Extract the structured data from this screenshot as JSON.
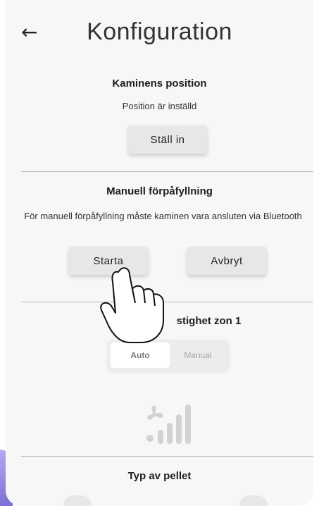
{
  "header": {
    "back_icon": "arrow-left-icon",
    "title": "Konfiguration"
  },
  "position_section": {
    "title": "Kaminens position",
    "status": "Position är inställd",
    "set_button_label": "Ställ in"
  },
  "prefill_section": {
    "title": "Manuell förpåfyllning",
    "description": "För manuell förpåfyllning måste kaminen vara ansluten via Bluetooth",
    "start_button_label": "Starta",
    "cancel_button_label": "Avbryt"
  },
  "fan_section": {
    "title": "stighet zon 1",
    "auto_label": "Auto",
    "manual_label": "Manual",
    "fan_icon": "fan-speed-icon"
  },
  "pellet_section": {
    "title": "Typ av pellet"
  },
  "colors": {
    "screen_bg": "#f7f7f7",
    "button_bg": "#e7e7e7",
    "accent": "#7c70d6"
  }
}
